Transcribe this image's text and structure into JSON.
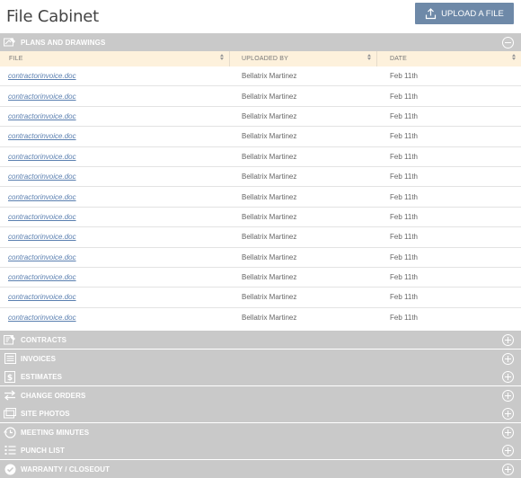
{
  "header": {
    "title": "File Cabinet",
    "upload_label": "UPLOAD A FILE"
  },
  "expanded_section": {
    "label": "PLANS AND DRAWINGS",
    "icon": "plans-icon",
    "columns": [
      {
        "label": "FILE"
      },
      {
        "label": "UPLOADED BY"
      },
      {
        "label": "DATE"
      }
    ],
    "rows": [
      {
        "file": "contractorinvoice.doc",
        "uploaded_by": "Bellatrix Martinez",
        "date": "Feb 11th"
      },
      {
        "file": "contractorinvoice.doc",
        "uploaded_by": "Bellatrix Martinez",
        "date": "Feb 11th"
      },
      {
        "file": "contractorinvoice.doc",
        "uploaded_by": "Bellatrix Martinez",
        "date": "Feb 11th"
      },
      {
        "file": "contractorinvoice.doc",
        "uploaded_by": "Bellatrix Martinez",
        "date": "Feb 11th"
      },
      {
        "file": "contractorinvoice.doc",
        "uploaded_by": "Bellatrix Martinez",
        "date": "Feb 11th"
      },
      {
        "file": "contractorinvoice.doc",
        "uploaded_by": "Bellatrix Martinez",
        "date": "Feb 11th"
      },
      {
        "file": "contractorinvoice.doc",
        "uploaded_by": "Bellatrix Martinez",
        "date": "Feb 11th"
      },
      {
        "file": "contractorinvoice.doc",
        "uploaded_by": "Bellatrix Martinez",
        "date": "Feb 11th"
      },
      {
        "file": "contractorinvoice.doc",
        "uploaded_by": "Bellatrix Martinez",
        "date": "Feb 11th"
      },
      {
        "file": "contractorinvoice.doc",
        "uploaded_by": "Bellatrix Martinez",
        "date": "Feb 11th"
      },
      {
        "file": "contractorinvoice.doc",
        "uploaded_by": "Bellatrix Martinez",
        "date": "Feb 11th"
      },
      {
        "file": "contractorinvoice.doc",
        "uploaded_by": "Bellatrix Martinez",
        "date": "Feb 11th"
      },
      {
        "file": "contractorinvoice.doc",
        "uploaded_by": "Bellatrix Martinez",
        "date": "Feb 11th"
      }
    ]
  },
  "collapsed_sections": [
    {
      "label": "CONTRACTS",
      "icon": "contracts-icon"
    },
    {
      "label": "INVOICES",
      "icon": "invoices-icon"
    },
    {
      "label": "ESTIMATES",
      "icon": "estimates-icon"
    },
    {
      "label": "CHANGE ORDERS",
      "icon": "change-orders-icon"
    },
    {
      "label": "SITE PHOTOS",
      "icon": "site-photos-icon"
    },
    {
      "label": "MEETING MINUTES",
      "icon": "meeting-minutes-icon"
    },
    {
      "label": "PUNCH LIST",
      "icon": "punch-list-icon"
    },
    {
      "label": "WARRANTY / CLOSEOUT",
      "icon": "warranty-icon"
    }
  ],
  "colors": {
    "section_bg": "#c9c9c9",
    "column_header_bg": "#fdf1dc",
    "upload_button": "#6e89a8",
    "link": "#5a7fb0"
  }
}
